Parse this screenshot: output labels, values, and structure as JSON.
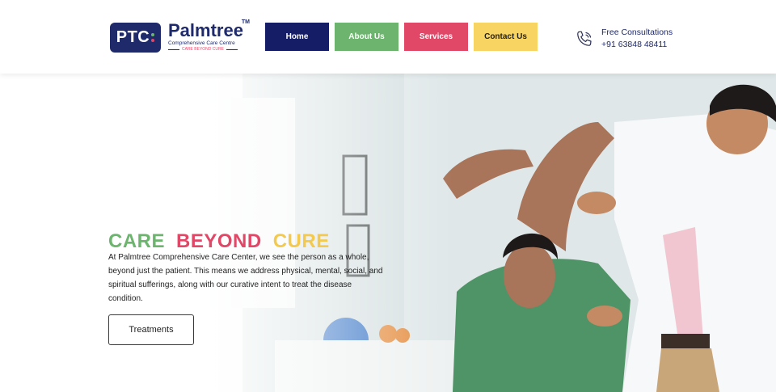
{
  "brand": {
    "badge": "PTC",
    "name": "Palmtree",
    "tm": "TM",
    "subtitle": "Comprehensive Care Centre",
    "tagline": "CARE BEYOND CURE",
    "badge_dot_colors": [
      "#6db56f",
      "#e14767",
      "#f8d562"
    ]
  },
  "nav": {
    "items": [
      {
        "label": "Home"
      },
      {
        "label": "About Us"
      },
      {
        "label": "Services"
      },
      {
        "label": "Contact Us"
      }
    ]
  },
  "contact": {
    "icon": "phone-icon",
    "label": "Free Consultations",
    "phone": "+91 63848 48411"
  },
  "hero": {
    "headline": {
      "word1": "CARE",
      "word2": "BEYOND",
      "word3": "CURE"
    },
    "description": "At Palmtree Comprehensive Care Center, we see the person as a whole, beyond just the patient. This means we address physical, mental, social, and spiritual sufferings, along with our curative intent to treat the disease condition.",
    "cta_label": "Treatments"
  },
  "colors": {
    "primary": "#151d66",
    "green": "#6db56f",
    "pink": "#e14767",
    "yellow": "#f8d562"
  }
}
